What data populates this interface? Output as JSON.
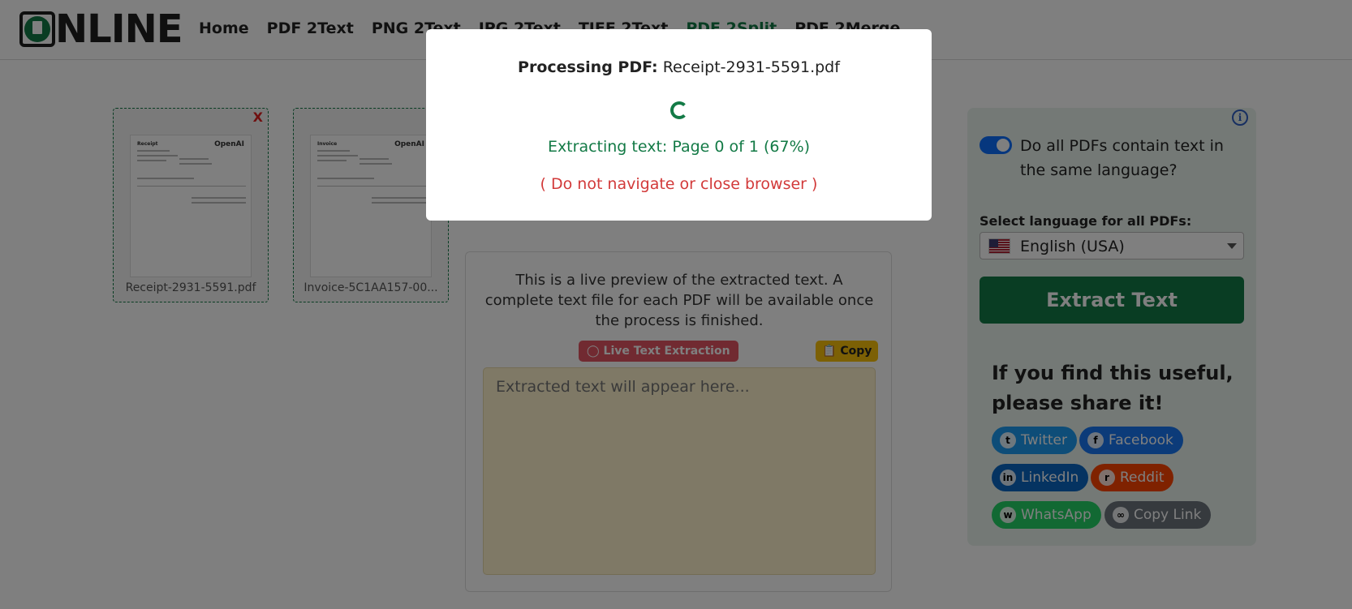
{
  "header": {
    "logo_text": "NLINE",
    "nav": [
      "Home",
      "PDF 2Text",
      "PNG 2Text",
      "JPG 2Text",
      "TIFF 2Text",
      "PDF 2Split",
      "PDF 2Merge"
    ]
  },
  "files": [
    {
      "name": "Receipt-2931-5591.pdf",
      "close": "X",
      "doc_title": "Receipt",
      "brand": "OpenAI"
    },
    {
      "name": "Invoice-5C1AA157-00...",
      "doc_title": "Invoice",
      "brand": "OpenAI"
    }
  ],
  "preview": {
    "message": "This is a live preview of the extracted text. A complete text file for each PDF will be available once the process is finished.",
    "live_badge": "Live Text Extraction",
    "copy_label": "Copy",
    "placeholder": "Extracted text will appear here..."
  },
  "sidebar": {
    "toggle_label": "Do all PDFs contain text in the same language?",
    "toggle_on": true,
    "select_label": "Select language for all PDFs:",
    "language": "English (USA)",
    "extract_label": "Extract Text",
    "share_title": "If you find this useful, please share it!",
    "share": [
      {
        "label": "Twitter",
        "color": "#1d9bf0",
        "icon": "twitter-icon"
      },
      {
        "label": "Facebook",
        "color": "#1877f2",
        "icon": "facebook-icon"
      },
      {
        "label": "LinkedIn",
        "color": "#0a66c2",
        "icon": "linkedin-icon"
      },
      {
        "label": "Reddit",
        "color": "#ff4500",
        "icon": "reddit-icon"
      },
      {
        "label": "WhatsApp",
        "color": "#25d366",
        "icon": "whatsapp-icon"
      },
      {
        "label": "Copy Link",
        "color": "#6c757d",
        "icon": "link-icon"
      }
    ]
  },
  "modal": {
    "title_prefix": "Processing PDF:",
    "filename": "Receipt-2931-5591.pdf",
    "status": "Extracting text: Page 0 of 1 (67%)",
    "progress_percent": 67,
    "warning": "( Do not navigate or close browser )"
  },
  "colors": {
    "brand_green": "#137a46",
    "overlay": "rgba(0,0,0,0.5)",
    "warning_red": "#d23a3a"
  }
}
